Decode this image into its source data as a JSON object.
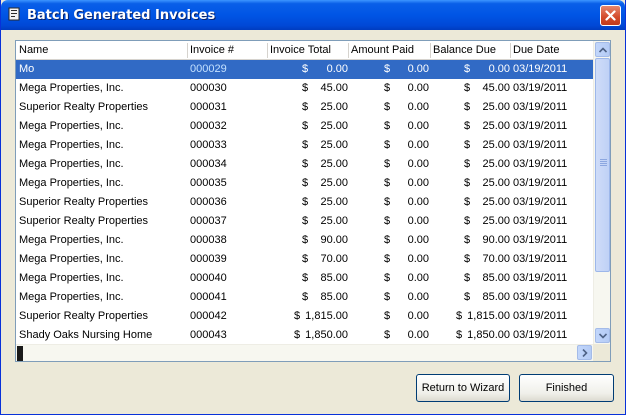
{
  "window": {
    "title": "Batch Generated Invoices"
  },
  "columns": {
    "name": "Name",
    "invoice": "Invoice #",
    "total": "Invoice Total",
    "paid": "Amount Paid",
    "balance": "Balance Due",
    "due": "Due Date"
  },
  "rows": [
    {
      "name": "Mo",
      "invoice": "000029",
      "total": "0.00",
      "paid": "0.00",
      "balance": "0.00",
      "due": "03/19/2011",
      "selected": true
    },
    {
      "name": "Mega Properties, Inc.",
      "invoice": "000030",
      "total": "45.00",
      "paid": "0.00",
      "balance": "45.00",
      "due": "03/19/2011"
    },
    {
      "name": "Superior Realty Properties",
      "invoice": "000031",
      "total": "25.00",
      "paid": "0.00",
      "balance": "25.00",
      "due": "03/19/2011"
    },
    {
      "name": "Mega Properties, Inc.",
      "invoice": "000032",
      "total": "25.00",
      "paid": "0.00",
      "balance": "25.00",
      "due": "03/19/2011"
    },
    {
      "name": "Mega Properties, Inc.",
      "invoice": "000033",
      "total": "25.00",
      "paid": "0.00",
      "balance": "25.00",
      "due": "03/19/2011"
    },
    {
      "name": "Mega Properties, Inc.",
      "invoice": "000034",
      "total": "25.00",
      "paid": "0.00",
      "balance": "25.00",
      "due": "03/19/2011"
    },
    {
      "name": "Mega Properties, Inc.",
      "invoice": "000035",
      "total": "25.00",
      "paid": "0.00",
      "balance": "25.00",
      "due": "03/19/2011"
    },
    {
      "name": "Superior Realty Properties",
      "invoice": "000036",
      "total": "25.00",
      "paid": "0.00",
      "balance": "25.00",
      "due": "03/19/2011"
    },
    {
      "name": "Superior Realty Properties",
      "invoice": "000037",
      "total": "25.00",
      "paid": "0.00",
      "balance": "25.00",
      "due": "03/19/2011"
    },
    {
      "name": "Mega Properties, Inc.",
      "invoice": "000038",
      "total": "90.00",
      "paid": "0.00",
      "balance": "90.00",
      "due": "03/19/2011"
    },
    {
      "name": "Mega Properties, Inc.",
      "invoice": "000039",
      "total": "70.00",
      "paid": "0.00",
      "balance": "70.00",
      "due": "03/19/2011"
    },
    {
      "name": "Mega Properties, Inc.",
      "invoice": "000040",
      "total": "85.00",
      "paid": "0.00",
      "balance": "85.00",
      "due": "03/19/2011"
    },
    {
      "name": "Mega Properties, Inc.",
      "invoice": "000041",
      "total": "85.00",
      "paid": "0.00",
      "balance": "85.00",
      "due": "03/19/2011"
    },
    {
      "name": "Superior Realty Properties",
      "invoice": "000042",
      "total": "1,815.00",
      "paid": "0.00",
      "balance": "1,815.00",
      "due": "03/19/2011"
    },
    {
      "name": "Shady Oaks Nursing Home",
      "invoice": "000043",
      "total": "1,850.00",
      "paid": "0.00",
      "balance": "1,850.00",
      "due": "03/19/2011"
    }
  ],
  "currency_symbol": "$",
  "buttons": {
    "return_label": "Return to Wizard",
    "finished_label": "Finished"
  },
  "colors": {
    "title_bar": "#0055e5",
    "selection": "#316ac5",
    "close_button": "#d34a2a"
  },
  "icons": {
    "title": "window-app-icon",
    "close": "close-icon",
    "scroll_up": "chevron-up-icon",
    "scroll_down": "chevron-down-icon",
    "scroll_right": "chevron-right-icon"
  }
}
